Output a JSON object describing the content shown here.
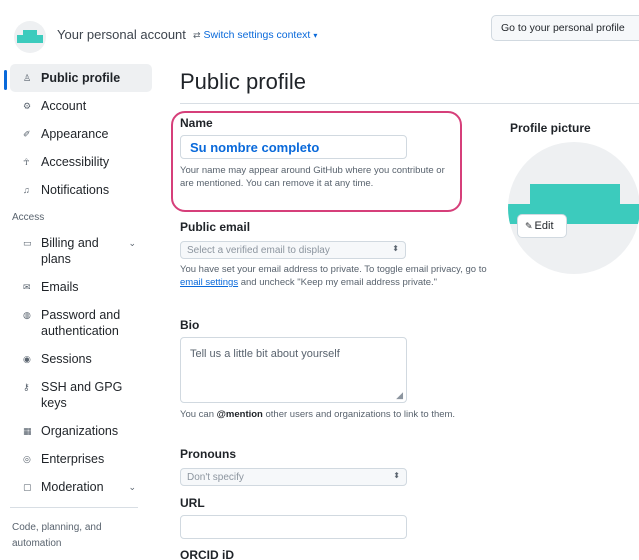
{
  "header": {
    "context_text": "Your personal account",
    "switch_icon": "arrow-switch-icon",
    "switch_label": "Switch settings context",
    "personal_profile_button": "Go to your personal profile"
  },
  "sidebar": {
    "items": [
      {
        "icon": "person-icon",
        "glyph": "♙",
        "label": "Public profile",
        "active": true
      },
      {
        "icon": "gear-icon",
        "glyph": "⚙",
        "label": "Account"
      },
      {
        "icon": "paintbrush-icon",
        "glyph": "✐",
        "label": "Appearance"
      },
      {
        "icon": "accessibility-icon",
        "glyph": "☥",
        "label": "Accessibility"
      },
      {
        "icon": "bell-icon",
        "glyph": "♫",
        "label": "Notifications"
      }
    ],
    "access_heading": "Access",
    "access_items": [
      {
        "icon": "credit-card-icon",
        "glyph": "▭",
        "label": "Billing and plans",
        "chevron": true
      },
      {
        "icon": "mail-icon",
        "glyph": "✉",
        "label": "Emails"
      },
      {
        "icon": "shield-lock-icon",
        "glyph": "◍",
        "label": "Password and authentication"
      },
      {
        "icon": "broadcast-icon",
        "glyph": "◉",
        "label": "Sessions"
      },
      {
        "icon": "key-icon",
        "glyph": "⚷",
        "label": "SSH and GPG keys"
      },
      {
        "icon": "organization-icon",
        "glyph": "▦",
        "label": "Organizations"
      },
      {
        "icon": "globe-icon",
        "glyph": "◎",
        "label": "Enterprises"
      },
      {
        "icon": "report-icon",
        "glyph": "▢",
        "label": "Moderation",
        "chevron": true
      }
    ],
    "code_heading": "Code, planning, and automation"
  },
  "main": {
    "title": "Public profile",
    "name": {
      "label": "Name",
      "value": "Su nombre completo",
      "note": "Your name may appear around GitHub where you contribute or are mentioned. You can remove it at any time."
    },
    "public_email": {
      "label": "Public email",
      "select_value": "Select a verified email to display",
      "note_before": "You have set your email address to private. To toggle email privacy, go to ",
      "note_link": "email settings",
      "note_after": " and uncheck \"Keep my email address private.\""
    },
    "bio": {
      "label": "Bio",
      "placeholder": "Tell us a little bit about yourself",
      "note_before": "You can ",
      "note_mention": "@mention",
      "note_after": " other users and organizations to link to them."
    },
    "pronouns": {
      "label": "Pronouns",
      "select_value": "Don't specify"
    },
    "url": {
      "label": "URL",
      "value": ""
    },
    "orcid": {
      "label": "ORCID iD"
    }
  },
  "profile_picture": {
    "label": "Profile picture",
    "edit_label": "Edit",
    "edit_icon": "pencil-icon"
  },
  "colors": {
    "accent": "#0969da",
    "highlight": "#d63f7a",
    "identicon": "#3ccbbd"
  }
}
